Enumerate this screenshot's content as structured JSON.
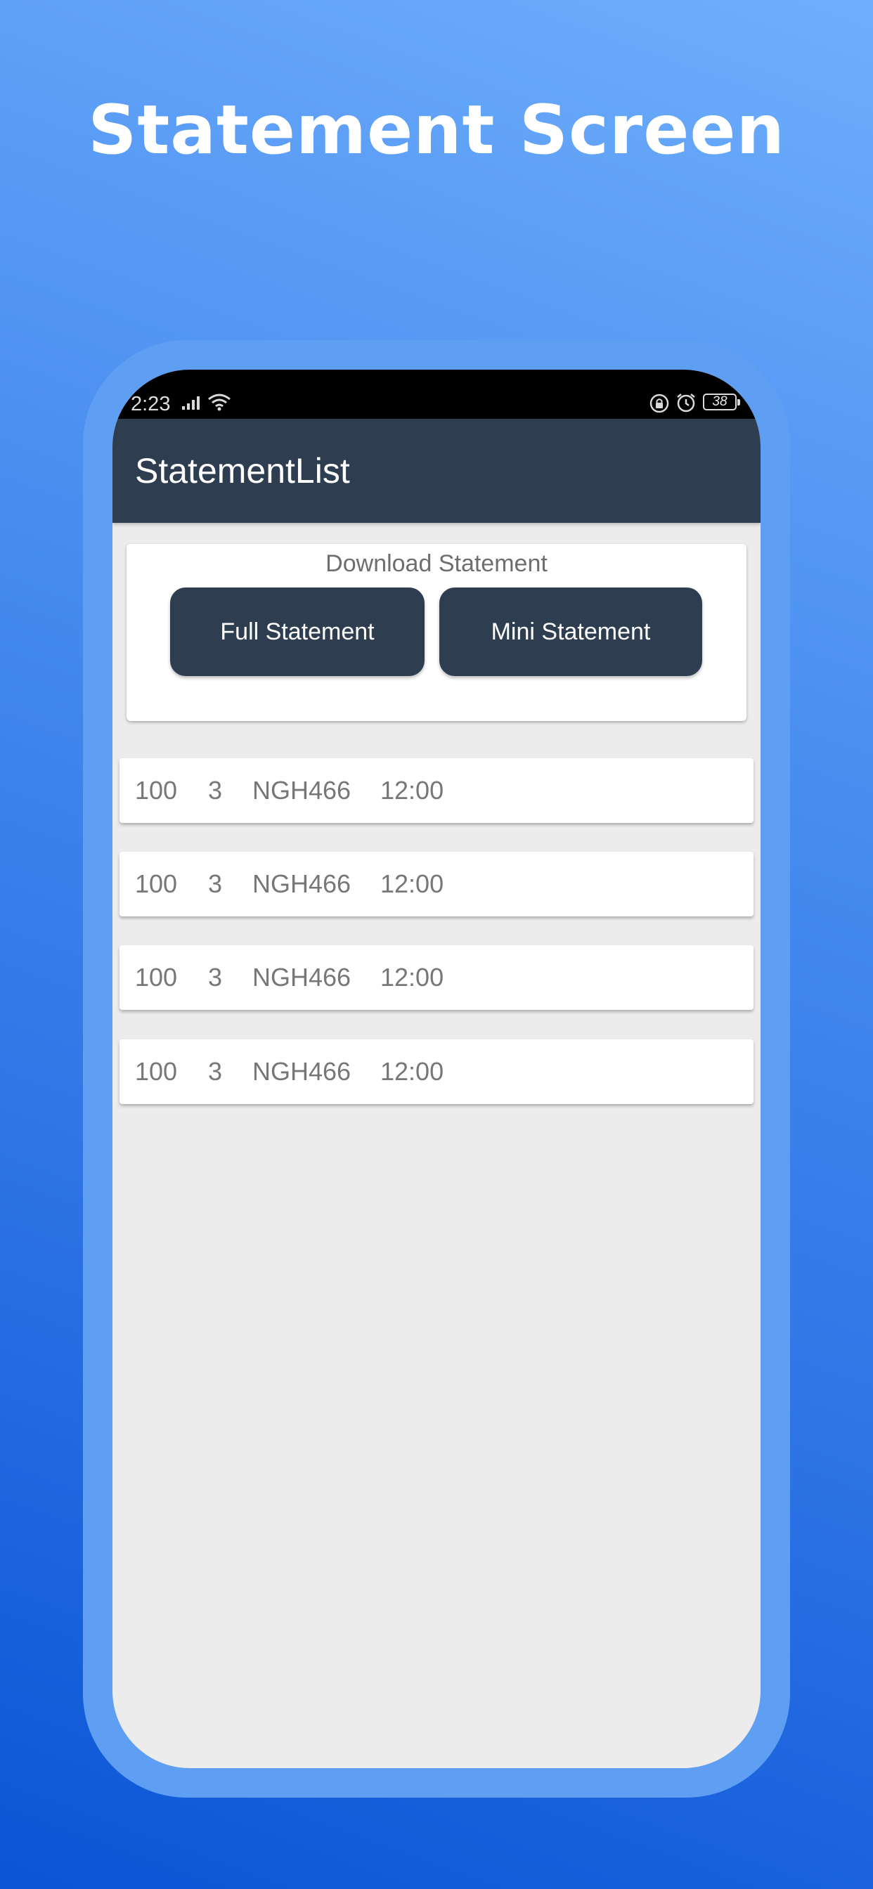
{
  "promo": {
    "title": "Statement Screen"
  },
  "status_bar": {
    "time": "2:23",
    "battery": "38",
    "icons": [
      "signal-icon",
      "wifi-icon",
      "lock-icon",
      "alarm-icon",
      "battery-icon"
    ]
  },
  "app_bar": {
    "title": "StatementList"
  },
  "download": {
    "title": "Download Statement",
    "full_label": "Full Statement",
    "mini_label": "Mini Statement"
  },
  "statements": [
    {
      "amount": "100",
      "count": "3",
      "ref": "NGH466",
      "time": "12:00"
    },
    {
      "amount": "100",
      "count": "3",
      "ref": "NGH466",
      "time": "12:00"
    },
    {
      "amount": "100",
      "count": "3",
      "ref": "NGH466",
      "time": "12:00"
    },
    {
      "amount": "100",
      "count": "3",
      "ref": "NGH466",
      "time": "12:00"
    }
  ],
  "colors": {
    "app_bar": "#2e3e50",
    "button": "#2e3e50",
    "screen_background": "#ececec",
    "phone_frame": "#5f9ff3",
    "page_gradient_top": "#6eaefc",
    "page_gradient_bottom": "#0a55d6"
  }
}
